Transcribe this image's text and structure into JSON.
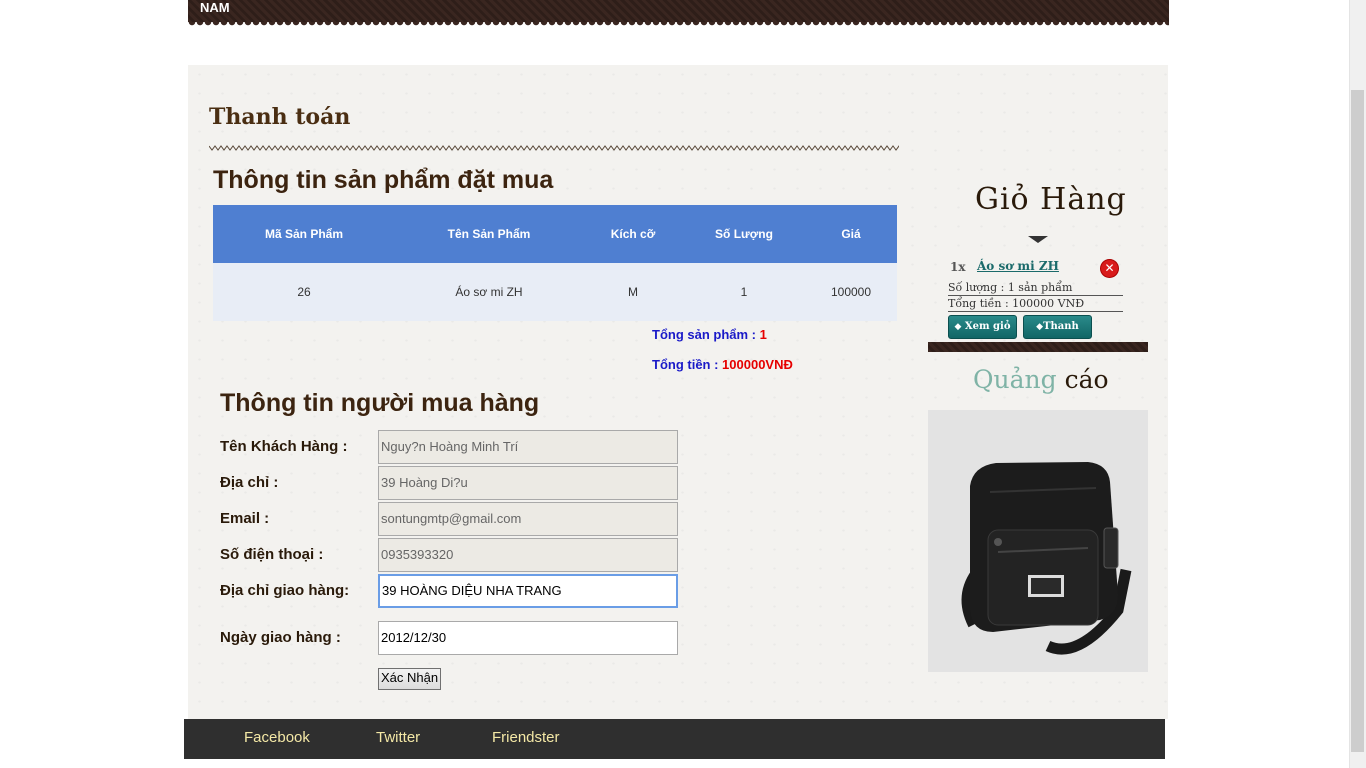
{
  "topbar": {
    "item": "NAM"
  },
  "page": {
    "title": "Thanh toán"
  },
  "order_section": {
    "title": "Thông tin sản phẩm đặt mua",
    "columns": [
      "Mã Sản Phẩm",
      "Tên Sản Phẩm",
      "Kích cỡ",
      "Số Lượng",
      "Giá"
    ],
    "rows": [
      [
        "26",
        "Áo sơ mi ZH",
        "M",
        "1",
        "100000"
      ]
    ],
    "total_products_label": "Tổng sản phẩm : ",
    "total_products_value": "1",
    "total_price_label": "Tổng tiền : ",
    "total_price_value": "100000VNĐ"
  },
  "buyer_section": {
    "title": "Thông tin người mua hàng",
    "fields": [
      {
        "label": "Tên Khách Hàng :",
        "value": "Nguy?n Hoàng Minh Trí"
      },
      {
        "label": "Địa chỉ :",
        "value": "39 Hoàng Di?u"
      },
      {
        "label": "Email :",
        "value": "sontungmtp@gmail.com"
      },
      {
        "label": "Số điện thoại :",
        "value": "0935393320"
      },
      {
        "label": "Địa chỉ giao hàng:",
        "value": "39 HOÀNG DIỆU NHA TRANG"
      },
      {
        "label": "Ngày giao hàng :",
        "value": "2012/12/30"
      }
    ],
    "submit_label": "Xác Nhận"
  },
  "cart": {
    "title": "Giỏ Hàng",
    "item_qty": "1x",
    "item_name": "Áo sơ mi ZH",
    "qty_line": "Số lượng : 1 sản phẩm",
    "total_line": "Tổng tiền : 100000 VNĐ",
    "view_button": "Xem giỏ",
    "checkout_button": "Thanh toán"
  },
  "ads": {
    "title_word1": "Quảng",
    "title_word2": "cáo"
  },
  "footer": {
    "links": [
      "Facebook",
      "Twitter",
      "Friendster"
    ]
  }
}
